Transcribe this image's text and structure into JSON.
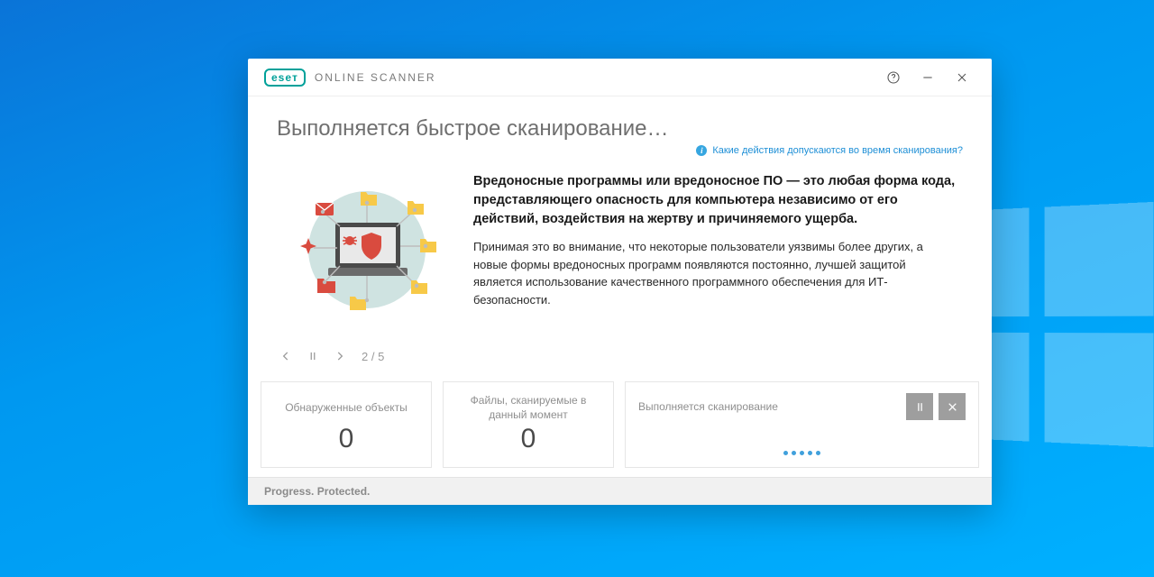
{
  "titlebar": {
    "brand": "eseт",
    "app_title": "ONLINE SCANNER"
  },
  "heading": "Выполняется быстрое сканирование…",
  "sub_link": "Какие действия допускаются во время сканирования?",
  "slide": {
    "headline": "Вредоносные программы или вредоносное ПО — это любая форма кода, представляющего опасность для компьютера независимо от его действий, воздействия на жертву и причиняемого ущерба.",
    "body": "Принимая это во внимание, что некоторые пользователи уязвимы более других, а новые формы вредоносных программ появляются постоянно, лучшей защитой является использование качественного программного обеспечения для ИТ-безопасности."
  },
  "carousel": {
    "current": 2,
    "total": 5,
    "indicator": "2 / 5"
  },
  "stats": {
    "detected_label": "Обнаруженные объекты",
    "detected_value": "0",
    "scanning_label": "Файлы, сканируемые в данный момент",
    "scanning_value": "0",
    "scan_status": "Выполняется сканирование"
  },
  "footer": "Progress. Protected."
}
